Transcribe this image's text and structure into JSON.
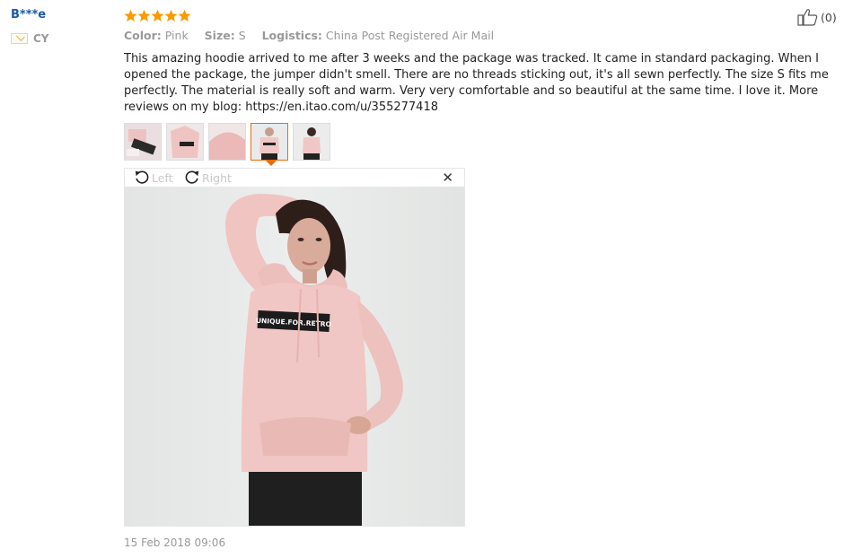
{
  "review": {
    "user": {
      "name": "B***e",
      "country_code": "CY"
    },
    "rating": 5,
    "rating_color": "#f99a00",
    "meta": [
      {
        "key": "Color:",
        "value": "Pink"
      },
      {
        "key": "Size:",
        "value": "S"
      },
      {
        "key": "Logistics:",
        "value": "China Post Registered Air Mail"
      }
    ],
    "text": "This amazing hoodie arrived to me after 3 weeks and the package was tracked. It came in standard packaging. When I opened the package, the jumper didn't smell. There are no threads sticking out, it's all sewn perfectly. The size S fits me perfectly. The material is really soft and warm. Very very comfortable and so beautiful at the same time. I love it. More reviews on my blog: https://en.itao.com/u/355277418",
    "date": "15 Feb 2018 09:06",
    "helpful_count": "(0)"
  },
  "viewer": {
    "rotate_left_label": "Left",
    "rotate_right_label": "Right",
    "close_glyph": "✕",
    "print_text": "UNIQUE.FOR.RETRO"
  },
  "icons": {
    "star": "star-icon",
    "rotate_left": "rotate-left-icon",
    "rotate_right": "rotate-right-icon",
    "thumbs_up": "thumbs-up-icon",
    "flag": "cyprus-flag-icon"
  },
  "colors": {
    "username": "#1a5aa6",
    "active_thumb": "#e96d0b",
    "hoodie": "#f0c8c6"
  }
}
